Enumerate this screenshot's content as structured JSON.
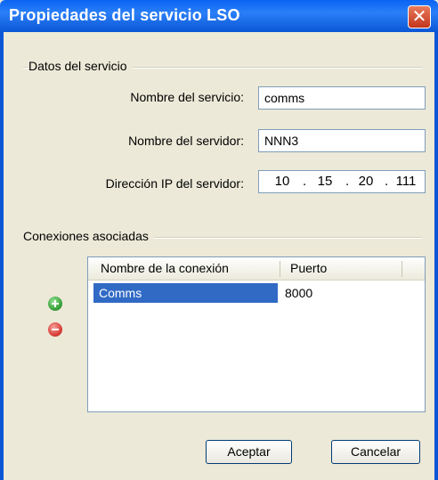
{
  "window": {
    "title": "Propiedades del servicio LSO",
    "close_glyph": "✕"
  },
  "service_group": {
    "label": "Datos del servicio",
    "service_name": {
      "label": "Nombre del servicio:",
      "value": "comms"
    },
    "server_name": {
      "label": "Nombre del servidor:",
      "value": "NNN3"
    },
    "server_ip": {
      "label": "Dirección IP del servidor:",
      "octets": [
        "10",
        "15",
        "20",
        "111"
      ],
      "separator": "."
    }
  },
  "connections_group": {
    "label": "Conexiones asociadas",
    "add_icon": "plus-circle-icon",
    "remove_icon": "minus-circle-icon",
    "table": {
      "columns": [
        "Nombre de la conexión",
        "Puerto"
      ],
      "rows": [
        {
          "name": "Comms",
          "port": "8000",
          "selected": true
        }
      ]
    }
  },
  "buttons": {
    "accept": "Aceptar",
    "cancel": "Cancelar"
  },
  "colors": {
    "titlebar": "#0b56d6",
    "selection": "#316ac5",
    "add": "#3aa33a",
    "remove": "#d9413a"
  }
}
